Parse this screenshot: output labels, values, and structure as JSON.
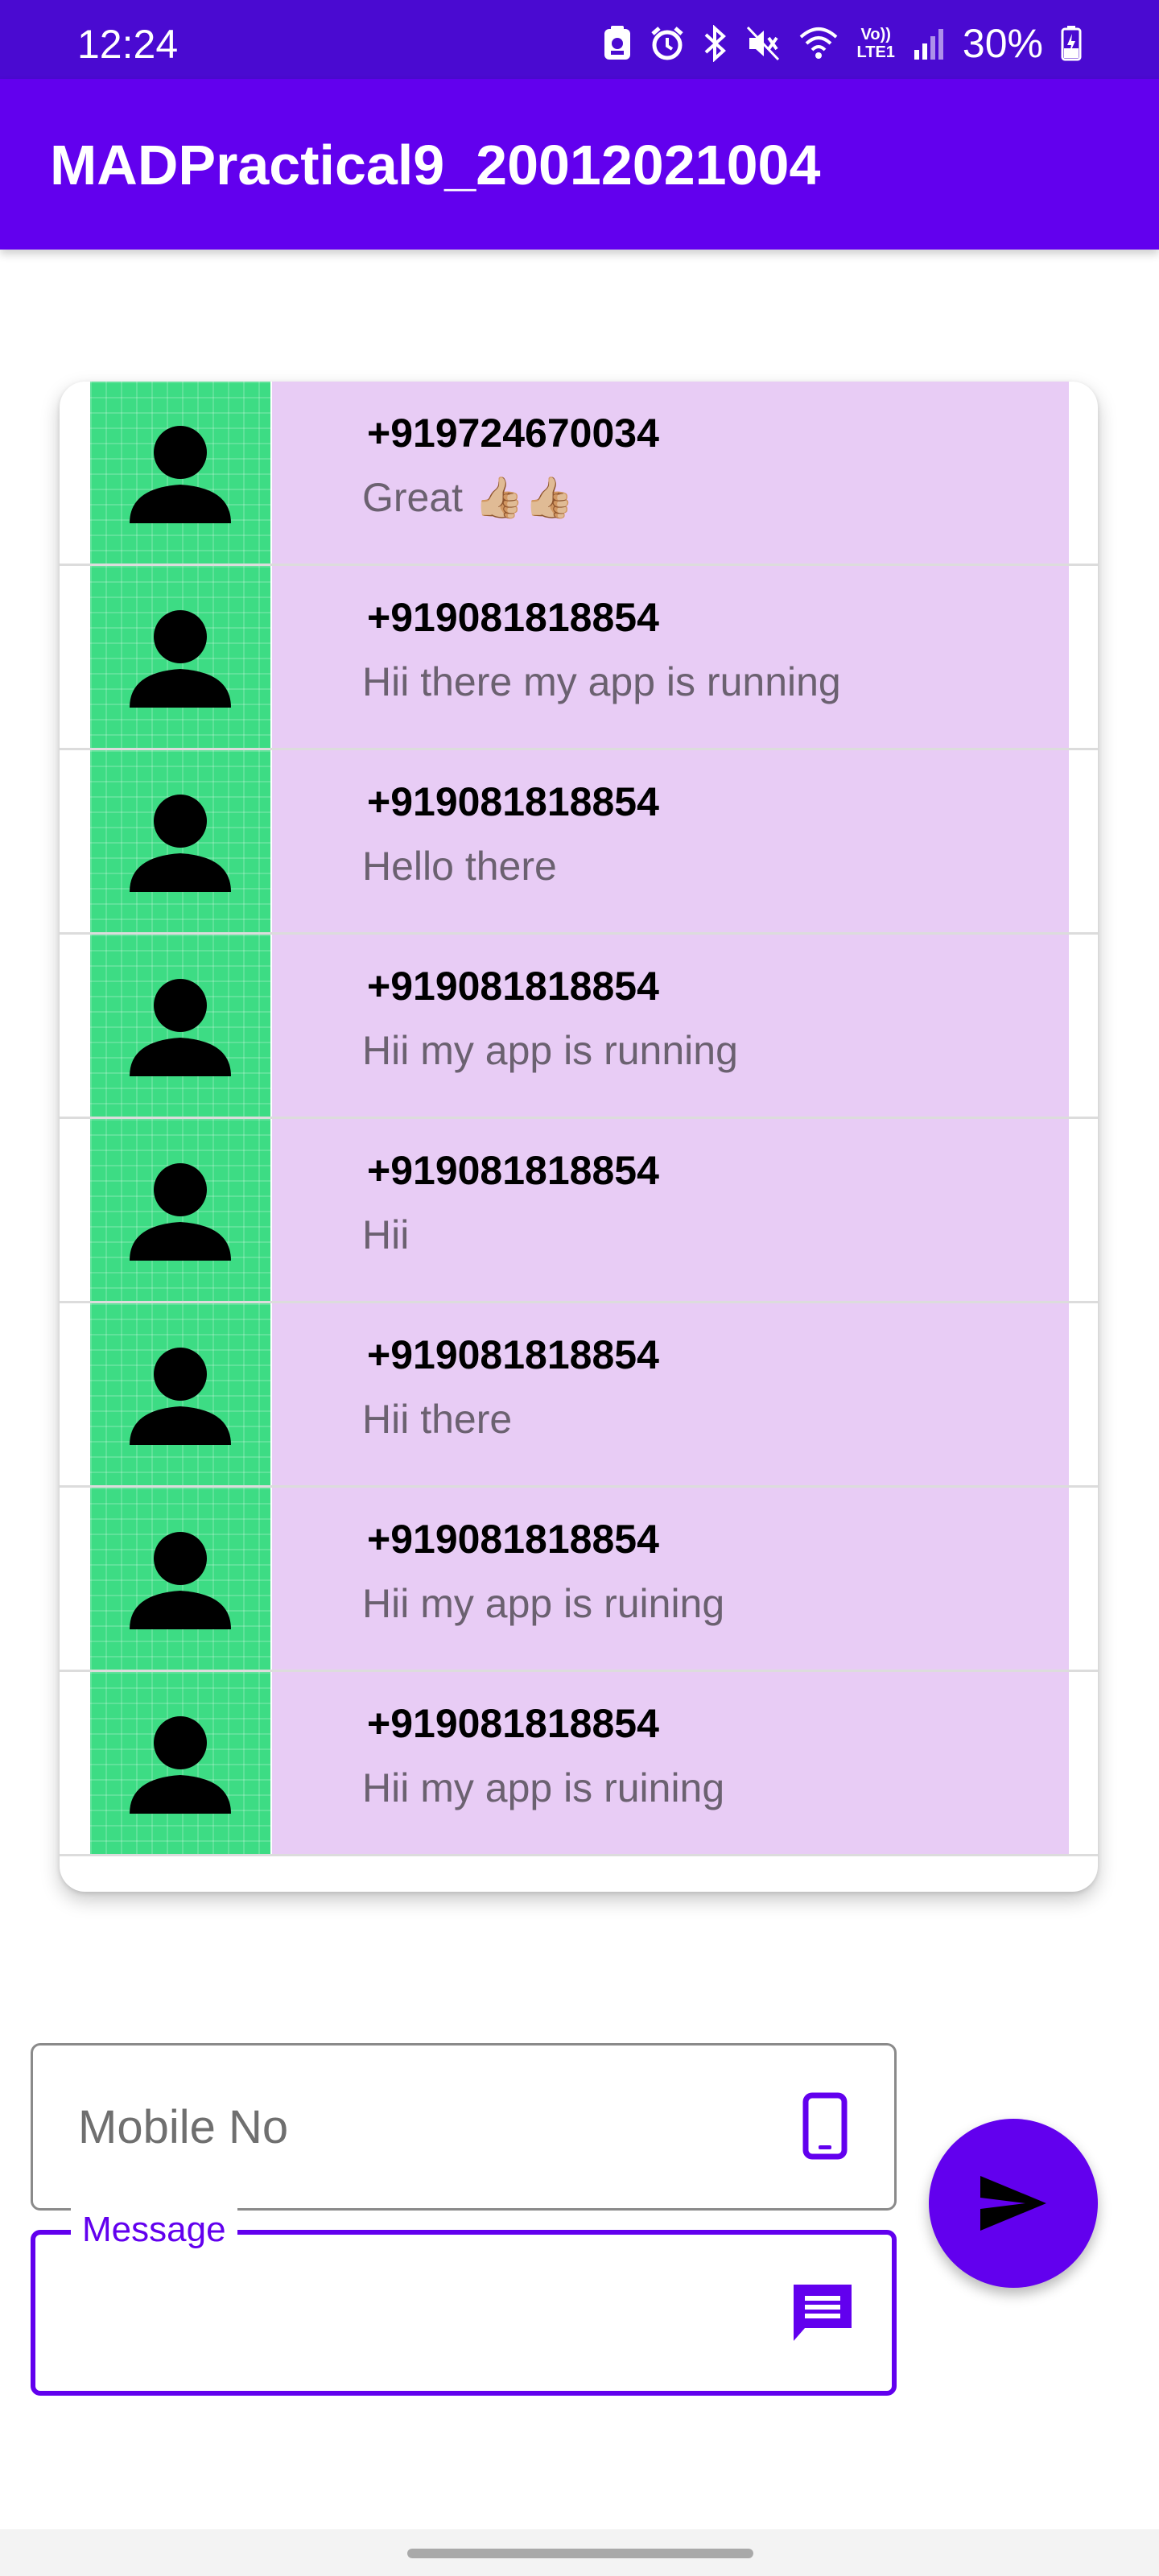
{
  "status_bar": {
    "time": "12:24",
    "battery_percent": "30%",
    "icons": [
      "app-notification-icon",
      "alarm-icon",
      "bluetooth-icon",
      "mute-icon",
      "wifi-icon",
      "volte-icon",
      "signal-icon",
      "battery-charging-icon"
    ],
    "volte_label_top": "Vo))",
    "volte_label_bottom": "LTE1"
  },
  "app_bar": {
    "title": "MADPractical9_20012021004"
  },
  "colors": {
    "primary": "#6200ee",
    "status_bar": "#4a0ad1",
    "avatar_bg": "#3ddc84",
    "row_bg": "#e8ccf5"
  },
  "sms_list": [
    {
      "phone": "+919724670034",
      "message": "Great 👍🏼👍🏼"
    },
    {
      "phone": "+919081818854",
      "message": "Hii there my app is running"
    },
    {
      "phone": "+919081818854",
      "message": "Hello there"
    },
    {
      "phone": "+919081818854",
      "message": "Hii my app is running"
    },
    {
      "phone": "+919081818854",
      "message": "Hii"
    },
    {
      "phone": "+919081818854",
      "message": "Hii there"
    },
    {
      "phone": "+919081818854",
      "message": "Hii my app is ruining"
    },
    {
      "phone": "+919081818854",
      "message": "Hii my app is ruining"
    }
  ],
  "form": {
    "mobile_placeholder": "Mobile No",
    "mobile_icon": "smartphone-icon",
    "message_label": "Message",
    "message_value": "",
    "message_icon": "message-icon",
    "send_icon": "send-icon"
  }
}
